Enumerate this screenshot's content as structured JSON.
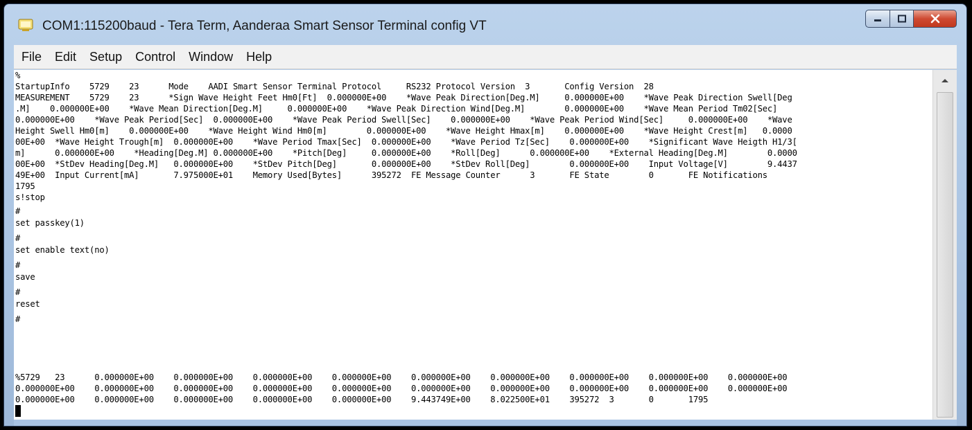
{
  "window": {
    "title": "COM1:115200baud - Tera Term, Aanderaa Smart Sensor Terminal config VT",
    "icon": "tera-term-icon",
    "controls": {
      "minimize": "minimize-icon",
      "maximize": "maximize-icon",
      "close": "close-icon"
    }
  },
  "menu": [
    "File",
    "Edit",
    "Setup",
    "Control",
    "Window",
    "Help"
  ],
  "terminal": {
    "lines": [
      "%",
      "StartupInfo    5729    23      Mode    AADI Smart Sensor Terminal Protocol     RS232 Protocol Version  3       Config Version  28",
      "MEASUREMENT    5729    23      *Sign Wave Height Feet Hm0[Ft]  0.000000E+00    *Wave Peak Direction[Deg.M]     0.000000E+00    *Wave Peak Direction Swell[Deg",
      ".M]    0.000000E+00    *Wave Mean Direction[Deg.M]     0.000000E+00    *Wave Peak Direction Wind[Deg.M]        0.000000E+00    *Wave Mean Period Tm02[Sec]",
      "0.000000E+00    *Wave Peak Period[Sec]  0.000000E+00    *Wave Peak Period Swell[Sec]    0.000000E+00    *Wave Peak Period Wind[Sec]     0.000000E+00    *Wave",
      "Height Swell Hm0[m]    0.000000E+00    *Wave Height Wind Hm0[m]        0.000000E+00    *Wave Height Hmax[m]    0.000000E+00    *Wave Height Crest[m]   0.0000",
      "00E+00  *Wave Height Trough[m]  0.000000E+00    *Wave Period Tmax[Sec]  0.000000E+00    *Wave Period Tz[Sec]    0.000000E+00    *Significant Wave Heigth H1/3[",
      "m]      0.000000E+00    *Heading[Deg.M] 0.000000E+00    *Pitch[Deg]     0.000000E+00    *Roll[Deg]      0.000000E+00    *External Heading[Deg.M]        0.0000",
      "00E+00  *StDev Heading[Deg.M]   0.000000E+00    *StDev Pitch[Deg]       0.000000E+00    *StDev Roll[Deg]        0.000000E+00    Input Voltage[V]        9.4437",
      "49E+00  Input Current[mA]       7.975000E+01    Memory Used[Bytes]      395272  FE Message Counter      3       FE State        0       FE Notifications",
      "1795",
      "s!stop",
      "#",
      "set passkey(1)",
      "#",
      "set enable text(no)",
      "#",
      "save",
      "#",
      "reset",
      "#",
      "%5729   23      0.000000E+00    0.000000E+00    0.000000E+00    0.000000E+00    0.000000E+00    0.000000E+00    0.000000E+00    0.000000E+00    0.000000E+00",
      "0.000000E+00    0.000000E+00    0.000000E+00    0.000000E+00    0.000000E+00    0.000000E+00    0.000000E+00    0.000000E+00    0.000000E+00    0.000000E+00",
      "0.000000E+00    0.000000E+00    0.000000E+00    0.000000E+00    0.000000E+00    9.443749E+00    8.022500E+01    395272  3       0       1795"
    ]
  }
}
